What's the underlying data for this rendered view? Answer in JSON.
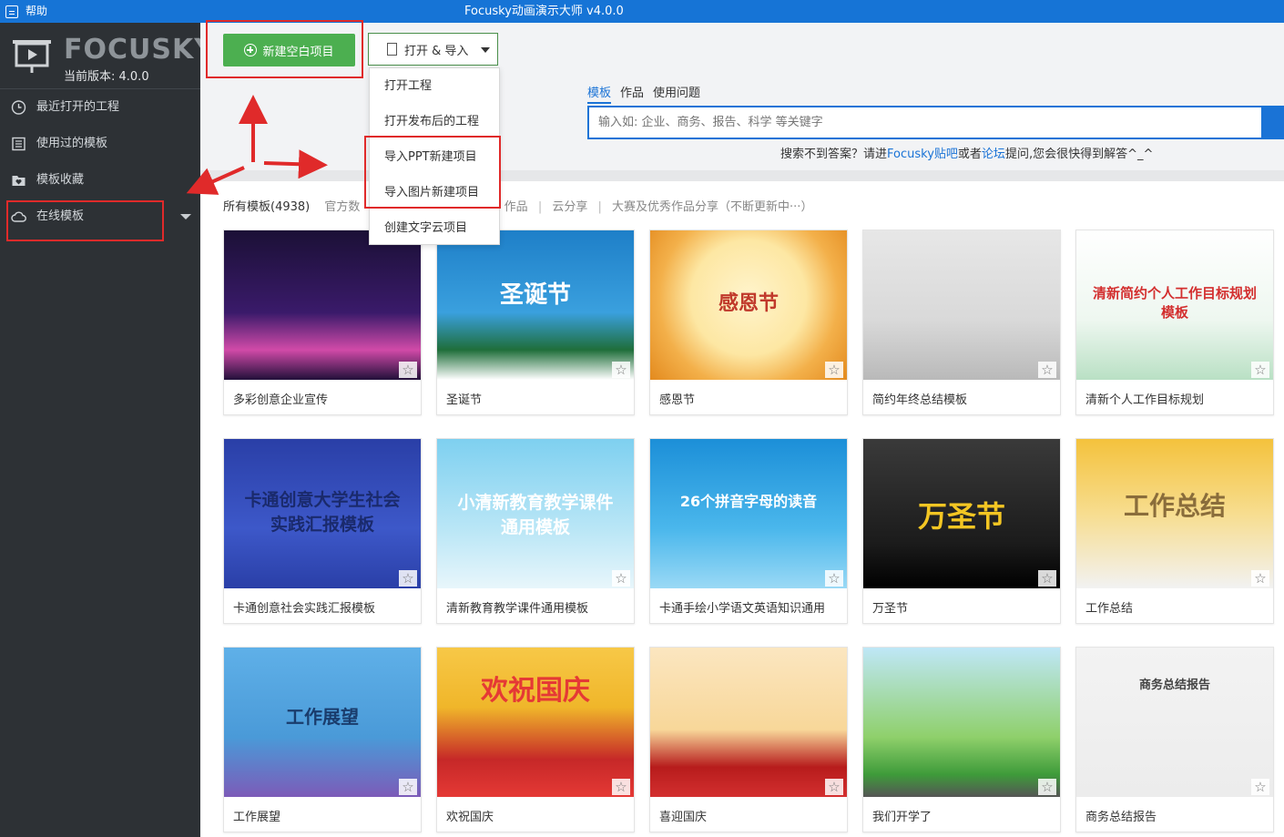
{
  "titlebar": {
    "help": "帮助",
    "title": "Focusky动画演示大师 v4.0.0"
  },
  "sidebar": {
    "logo": "FOCUSKY",
    "version": "当前版本: 4.0.0",
    "items": [
      {
        "label": "最近打开的工程",
        "icon": "clock-icon"
      },
      {
        "label": "使用过的模板",
        "icon": "template-icon"
      },
      {
        "label": "模板收藏",
        "icon": "heart-folder-icon"
      },
      {
        "label": "在线模板",
        "icon": "cloud-icon"
      }
    ]
  },
  "toolbar": {
    "new_project": "新建空白项目",
    "open_import": "打开 & 导入"
  },
  "dropdown": [
    "打开工程",
    "打开发布后的工程",
    "导入PPT新建项目",
    "导入图片新建项目",
    "创建文字云项目"
  ],
  "search": {
    "tabs": [
      "模板",
      "作品",
      "使用问题"
    ],
    "placeholder": "输入如: 企业、商务、报告、科学 等关键字",
    "help_prefix": "搜索不到答案？请进",
    "help_link1": "Focusky贴吧",
    "help_mid": "或者",
    "help_link2": "论坛",
    "help_suffix": "提问,您会很快得到解答^_^"
  },
  "categories": {
    "all": "所有模板(4938)",
    "official": "官方数",
    "works": "作品",
    "cloud": "云分享",
    "contest": "大赛及优秀作品分享（不断更新中···）"
  },
  "templates": [
    {
      "caption": "多彩创意企业宣传",
      "thumb_text": ""
    },
    {
      "caption": "圣诞节",
      "thumb_text": "圣诞节"
    },
    {
      "caption": "感恩节",
      "thumb_text": "感恩节"
    },
    {
      "caption": "简约年终总结模板",
      "thumb_text": ""
    },
    {
      "caption": "清新个人工作目标规划",
      "thumb_text": "清新简约个人工作目标规划模板"
    },
    {
      "caption": "卡通创意社会实践汇报模板",
      "thumb_text": "卡通创意大学生社会实践汇报模板"
    },
    {
      "caption": "清新教育教学课件通用模板",
      "thumb_text": "小清新教育教学课件通用模板"
    },
    {
      "caption": "卡通手绘小学语文英语知识通用",
      "thumb_text": "26个拼音字母的读音"
    },
    {
      "caption": "万圣节",
      "thumb_text": "万圣节"
    },
    {
      "caption": "工作总结",
      "thumb_text": "工作总结"
    },
    {
      "caption": "工作展望",
      "thumb_text": "工作展望"
    },
    {
      "caption": "欢祝国庆",
      "thumb_text": "欢祝国庆"
    },
    {
      "caption": "喜迎国庆",
      "thumb_text": ""
    },
    {
      "caption": "我们开学了",
      "thumb_text": ""
    },
    {
      "caption": "商务总结报告",
      "thumb_text": "商务总结报告"
    }
  ],
  "star_glyph": "☆",
  "colors": {
    "titlebar": "#1674d6",
    "sidebar": "#2d3135",
    "accent": "#1a73d6",
    "green": "#4caf50",
    "annotation": "#e02a2a"
  }
}
